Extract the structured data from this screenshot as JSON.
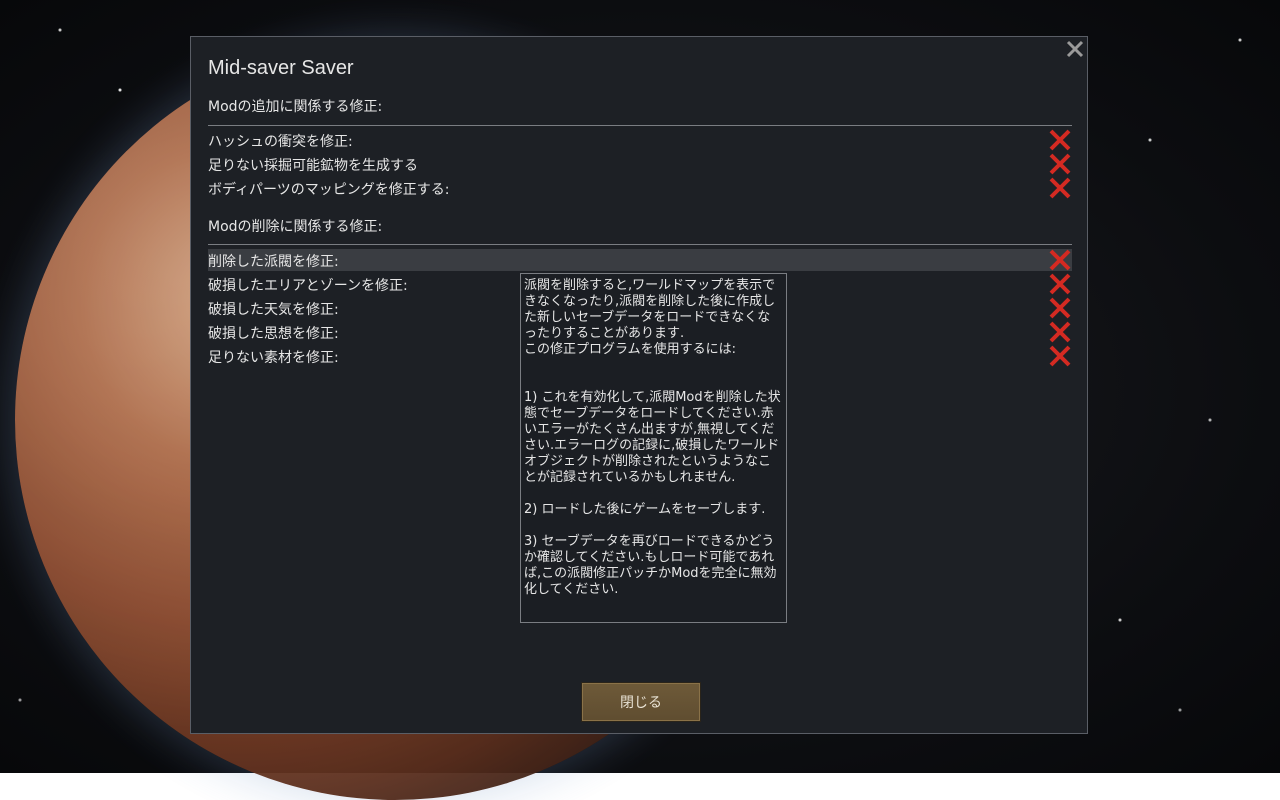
{
  "dialog": {
    "title": "Mid-saver Saver",
    "close_icon": "close-x-icon",
    "colors": {
      "accent_red": "#d42a22",
      "button": "#6e5a39"
    },
    "sections": [
      {
        "header": "Modの追加に関係する修正:",
        "items": [
          {
            "label": "ハッシュの衝突を修正:"
          },
          {
            "label": "足りない採掘可能鉱物を生成する"
          },
          {
            "label": "ボディパーツのマッピングを修正する:"
          }
        ]
      },
      {
        "header": "Modの削除に関係する修正:",
        "items": [
          {
            "label": "削除した派閥を修正:"
          },
          {
            "label": "破損したエリアとゾーンを修正:"
          },
          {
            "label": "破損した天気を修正:"
          },
          {
            "label": "破損した思想を修正:"
          },
          {
            "label": "足りない素材を修正:"
          }
        ]
      }
    ],
    "tooltip": "派閥を削除すると,ワールドマップを表示できなくなったり,派閥を削除した後に作成した新しいセーブデータをロードできなくなったりすることがあります.\nこの修正プログラムを使用するには:\n\n\n1) これを有効化して,派閥Modを削除した状態でセーブデータをロードしてください.赤いエラーがたくさん出ますが,無視してください.エラーログの記録に,破損したワールドオブジェクトが削除されたというようなことが記録されているかもしれません.\n\n2) ロードした後にゲームをセーブします.\n\n3) セーブデータを再びロードできるかどうか確認してください.もしロード可能であれば,この派閥修正パッチかModを完全に無効化してください.",
    "close_button": "閉じる"
  }
}
